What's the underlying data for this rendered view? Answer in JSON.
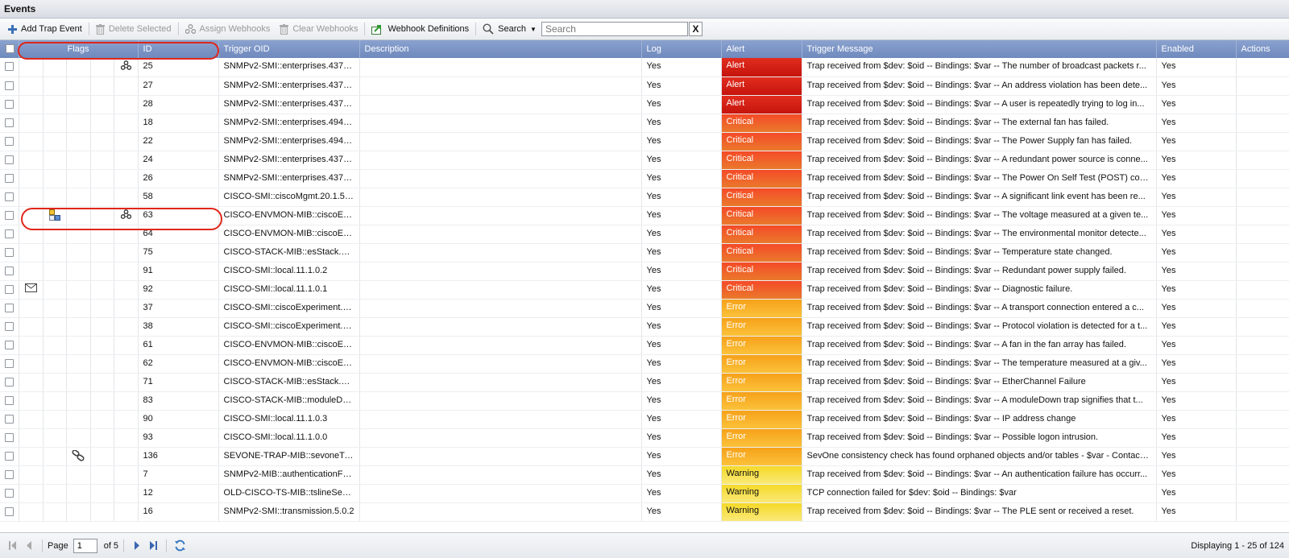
{
  "panel_title": "Events",
  "toolbar": {
    "add_label": "Add Trap Event",
    "delete_label": "Delete Selected",
    "assign_label": "Assign Webhooks",
    "clear_label": "Clear Webhooks",
    "definitions_label": "Webhook Definitions",
    "search_label": "Search",
    "search_placeholder": "Search",
    "clear_x": "X"
  },
  "columns": {
    "flags": "Flags",
    "id": "ID",
    "oid": "Trigger OID",
    "description": "Description",
    "log": "Log",
    "alert": "Alert",
    "message": "Trigger Message",
    "enabled": "Enabled",
    "actions": "Actions"
  },
  "rows": [
    {
      "id": "25",
      "oid": "SNMPv2-SMI::enterprises.437.1...",
      "description": "",
      "log": "Yes",
      "alert": "Alert",
      "msg": "Trap received from $dev: $oid -- Bindings: $var -- The number of broadcast packets r...",
      "enabled": "Yes",
      "icons": [
        "",
        "",
        "",
        "",
        "webhook-icon"
      ]
    },
    {
      "id": "27",
      "oid": "SNMPv2-SMI::enterprises.437.1...",
      "description": "",
      "log": "Yes",
      "alert": "Alert",
      "msg": "Trap received from $dev: $oid -- Bindings: $var -- An address violation has been dete...",
      "enabled": "Yes",
      "icons": [
        "",
        "",
        "",
        "",
        ""
      ]
    },
    {
      "id": "28",
      "oid": "SNMPv2-SMI::enterprises.437.1...",
      "description": "",
      "log": "Yes",
      "alert": "Alert",
      "msg": "Trap received from $dev: $oid -- Bindings: $var -- A user is repeatedly trying to log in...",
      "enabled": "Yes",
      "icons": [
        "",
        "",
        "",
        "",
        ""
      ]
    },
    {
      "id": "18",
      "oid": "SNMPv2-SMI::enterprises.494.4...",
      "description": "",
      "log": "Yes",
      "alert": "Critical",
      "msg": "Trap received from $dev: $oid -- Bindings: $var -- The external fan has failed.",
      "enabled": "Yes",
      "icons": [
        "",
        "",
        "",
        "",
        ""
      ]
    },
    {
      "id": "22",
      "oid": "SNMPv2-SMI::enterprises.494.4...",
      "description": "",
      "log": "Yes",
      "alert": "Critical",
      "msg": "Trap received from $dev: $oid -- Bindings: $var -- The Power Supply fan has failed.",
      "enabled": "Yes",
      "icons": [
        "",
        "",
        "",
        "",
        ""
      ]
    },
    {
      "id": "24",
      "oid": "SNMPv2-SMI::enterprises.437.1...",
      "description": "",
      "log": "Yes",
      "alert": "Critical",
      "msg": "Trap received from $dev: $oid -- Bindings: $var -- A redundant power source is conne...",
      "enabled": "Yes",
      "icons": [
        "",
        "",
        "",
        "",
        ""
      ]
    },
    {
      "id": "26",
      "oid": "SNMPv2-SMI::enterprises.437.1...",
      "description": "",
      "log": "Yes",
      "alert": "Critical",
      "msg": "Trap received from $dev: $oid -- Bindings: $var -- The Power On Self Test (POST) cod...",
      "enabled": "Yes",
      "icons": [
        "",
        "",
        "",
        "",
        ""
      ]
    },
    {
      "id": "58",
      "oid": "CISCO-SMI::ciscoMgmt.20.1.5....",
      "description": "",
      "log": "Yes",
      "alert": "Critical",
      "msg": "Trap received from $dev: $oid -- Bindings: $var -- A significant link event has been re...",
      "enabled": "Yes",
      "icons": [
        "",
        "",
        "",
        "",
        ""
      ]
    },
    {
      "id": "63",
      "oid": "CISCO-ENVMON-MIB::ciscoEnv...",
      "description": "",
      "log": "Yes",
      "alert": "Critical",
      "msg": "Trap received from $dev: $oid -- Bindings: $var -- The voltage measured at a given te...",
      "enabled": "Yes",
      "icons": [
        "",
        "policy-icon",
        "",
        "",
        "webhook-icon"
      ]
    },
    {
      "id": "64",
      "oid": "CISCO-ENVMON-MIB::ciscoEnv...",
      "description": "",
      "log": "Yes",
      "alert": "Critical",
      "msg": "Trap received from $dev: $oid -- Bindings: $var -- The environmental monitor detecte...",
      "enabled": "Yes",
      "icons": [
        "",
        "",
        "",
        "",
        ""
      ]
    },
    {
      "id": "75",
      "oid": "CISCO-STACK-MIB::esStack.2.0.3",
      "description": "",
      "log": "Yes",
      "alert": "Critical",
      "msg": "Trap received from $dev: $oid -- Bindings: $var -- Temperature state changed.",
      "enabled": "Yes",
      "icons": [
        "",
        "",
        "",
        "",
        ""
      ]
    },
    {
      "id": "91",
      "oid": "CISCO-SMI::local.11.1.0.2",
      "description": "",
      "log": "Yes",
      "alert": "Critical",
      "msg": "Trap received from $dev: $oid -- Bindings: $var -- Redundant power supply failed.",
      "enabled": "Yes",
      "icons": [
        "",
        "",
        "",
        "",
        ""
      ]
    },
    {
      "id": "92",
      "oid": "CISCO-SMI::local.11.1.0.1",
      "description": "",
      "log": "Yes",
      "alert": "Critical",
      "msg": "Trap received from $dev: $oid -- Bindings: $var -- Diagnostic failure.",
      "enabled": "Yes",
      "icons": [
        "mail-icon",
        "",
        "",
        "",
        ""
      ]
    },
    {
      "id": "37",
      "oid": "CISCO-SMI::ciscoExperiment.9....",
      "description": "",
      "log": "Yes",
      "alert": "Error",
      "msg": "Trap received from $dev: $oid -- Bindings: $var -- A transport connection entered a c...",
      "enabled": "Yes",
      "icons": [
        "",
        "",
        "",
        "",
        ""
      ]
    },
    {
      "id": "38",
      "oid": "CISCO-SMI::ciscoExperiment.9....",
      "description": "",
      "log": "Yes",
      "alert": "Error",
      "msg": "Trap received from $dev: $oid -- Bindings: $var -- Protocol violation is detected for a t...",
      "enabled": "Yes",
      "icons": [
        "",
        "",
        "",
        "",
        ""
      ]
    },
    {
      "id": "61",
      "oid": "CISCO-ENVMON-MIB::ciscoEnv...",
      "description": "",
      "log": "Yes",
      "alert": "Error",
      "msg": "Trap received from $dev: $oid -- Bindings: $var -- A fan in the fan array has failed.",
      "enabled": "Yes",
      "icons": [
        "",
        "",
        "",
        "",
        ""
      ]
    },
    {
      "id": "62",
      "oid": "CISCO-ENVMON-MIB::ciscoEnv...",
      "description": "",
      "log": "Yes",
      "alert": "Error",
      "msg": "Trap received from $dev: $oid -- Bindings: $var -- The temperature measured at a giv...",
      "enabled": "Yes",
      "icons": [
        "",
        "",
        "",
        "",
        ""
      ]
    },
    {
      "id": "71",
      "oid": "CISCO-STACK-MIB::esStack.6.0.7",
      "description": "",
      "log": "Yes",
      "alert": "Error",
      "msg": "Trap received from $dev: $oid -- Bindings: $var -- EtherChannel Failure",
      "enabled": "Yes",
      "icons": [
        "",
        "",
        "",
        "",
        ""
      ]
    },
    {
      "id": "83",
      "oid": "CISCO-STACK-MIB::moduleDown",
      "description": "",
      "log": "Yes",
      "alert": "Error",
      "msg": "Trap received from $dev: $oid -- Bindings: $var -- A moduleDown trap signifies that t...",
      "enabled": "Yes",
      "icons": [
        "",
        "",
        "",
        "",
        ""
      ]
    },
    {
      "id": "90",
      "oid": "CISCO-SMI::local.11.1.0.3",
      "description": "",
      "log": "Yes",
      "alert": "Error",
      "msg": "Trap received from $dev: $oid -- Bindings: $var -- IP address change",
      "enabled": "Yes",
      "icons": [
        "",
        "",
        "",
        "",
        ""
      ]
    },
    {
      "id": "93",
      "oid": "CISCO-SMI::local.11.1.0.0",
      "description": "",
      "log": "Yes",
      "alert": "Error",
      "msg": "Trap received from $dev: $oid -- Bindings: $var -- Possible logon intrusion.",
      "enabled": "Yes",
      "icons": [
        "",
        "",
        "",
        "",
        ""
      ]
    },
    {
      "id": "136",
      "oid": "SEVONE-TRAP-MIB::sevoneTra...",
      "description": "",
      "log": "Yes",
      "alert": "Error",
      "msg": "SevOne consistency check has found orphaned objects and/or tables - $var - Contact ...",
      "enabled": "Yes",
      "icons": [
        "",
        "",
        "link-icon",
        "",
        ""
      ]
    },
    {
      "id": "7",
      "oid": "SNMPv2-MIB::authenticationFai...",
      "description": "",
      "log": "Yes",
      "alert": "Warning",
      "msg": "Trap received from $dev: $oid -- Bindings: $var -- An authentication failure has occurr...",
      "enabled": "Yes",
      "icons": [
        "",
        "",
        "",
        "",
        ""
      ]
    },
    {
      "id": "12",
      "oid": "OLD-CISCO-TS-MIB::tslineSesT...",
      "description": "",
      "log": "Yes",
      "alert": "Warning",
      "msg": "TCP connection failed for $dev: $oid -- Bindings: $var",
      "enabled": "Yes",
      "icons": [
        "",
        "",
        "",
        "",
        ""
      ]
    },
    {
      "id": "16",
      "oid": "SNMPv2-SMI::transmission.5.0.2",
      "description": "",
      "log": "Yes",
      "alert": "Warning",
      "msg": "Trap received from $dev: $oid -- Bindings: $var -- The PLE sent or received a reset.",
      "enabled": "Yes",
      "icons": [
        "",
        "",
        "",
        "",
        ""
      ]
    }
  ],
  "severity_colors": {
    "Alert": "#d41c12",
    "Critical": "#f05a2a",
    "Error": "#f8b028",
    "Warning": "#f8e04a"
  },
  "paging": {
    "page_label": "Page",
    "page_value": "1",
    "of_label": "of 5",
    "display_text": "Displaying 1 - 25 of 124"
  }
}
